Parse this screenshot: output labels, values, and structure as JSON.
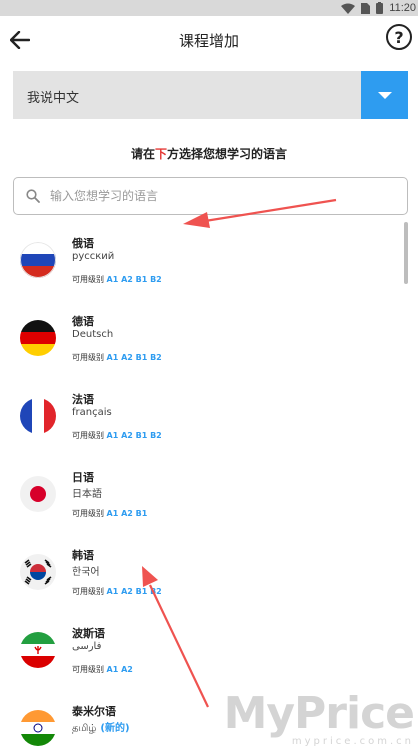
{
  "status_bar": {
    "time": "11:20"
  },
  "app_bar": {
    "title": "课程增加",
    "help_label": "?"
  },
  "native_language": {
    "selected": "我说中文"
  },
  "instruction": {
    "part1": "请在",
    "highlight": "下",
    "part2": "方选择您想学习的语言"
  },
  "search": {
    "placeholder": "输入您想学习的语言"
  },
  "levels_label": "可用级别",
  "languages": [
    {
      "name": "俄语",
      "native": "русский",
      "levels": "A1 A2 B1 B2",
      "flag": "russia"
    },
    {
      "name": "德语",
      "native": "Deutsch",
      "levels": "A1 A2 B1 B2",
      "flag": "germany"
    },
    {
      "name": "法语",
      "native": "français",
      "levels": "A1 A2 B1 B2",
      "flag": "france"
    },
    {
      "name": "日语",
      "native": "日本語",
      "levels": "A1 A2 B1",
      "flag": "japan"
    },
    {
      "name": "韩语",
      "native": "한국어",
      "levels": "A1 A2 B1 B2",
      "flag": "korea"
    },
    {
      "name": "波斯语",
      "native": "فارسی",
      "levels": "A1 A2",
      "flag": "iran"
    },
    {
      "name": "泰米尔语",
      "native": "தமிழ்",
      "native_tag": "(新的)",
      "levels": "",
      "flag": "india"
    }
  ],
  "watermark": {
    "brand": "MyPrice",
    "domain": "myprice.com.cn"
  }
}
